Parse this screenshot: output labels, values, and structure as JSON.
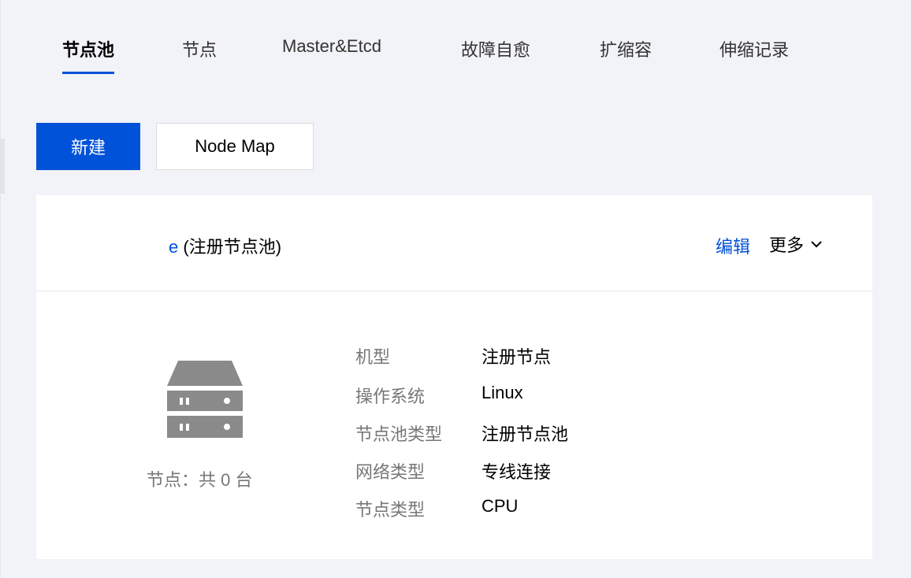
{
  "tabs": [
    {
      "label": "节点池",
      "active": true
    },
    {
      "label": "节点",
      "active": false
    },
    {
      "label": "Master&Etcd",
      "active": false
    },
    {
      "label": "故障自愈",
      "active": false
    },
    {
      "label": "扩缩容",
      "active": false
    },
    {
      "label": "伸缩记录",
      "active": false
    }
  ],
  "toolbar": {
    "create_label": "新建",
    "node_map_label": "Node Map"
  },
  "pool_card": {
    "title_fragment": "e",
    "title": "(注册节点池)",
    "edit_label": "编辑",
    "more_label": "更多",
    "node_count_text": "节点：共 0 台",
    "details": [
      {
        "label": "机型",
        "value": "注册节点"
      },
      {
        "label": "操作系统",
        "value": "Linux"
      },
      {
        "label": "节点池类型",
        "value": "注册节点池"
      },
      {
        "label": "网络类型",
        "value": "专线连接"
      },
      {
        "label": "节点类型",
        "value": "CPU"
      }
    ]
  },
  "colors": {
    "primary": "#0052d9",
    "background": "#f2f3f8",
    "icon_gray": "#8a8a8a"
  },
  "icons": {
    "server": "server-icon",
    "more": "chevron-down-icon"
  }
}
